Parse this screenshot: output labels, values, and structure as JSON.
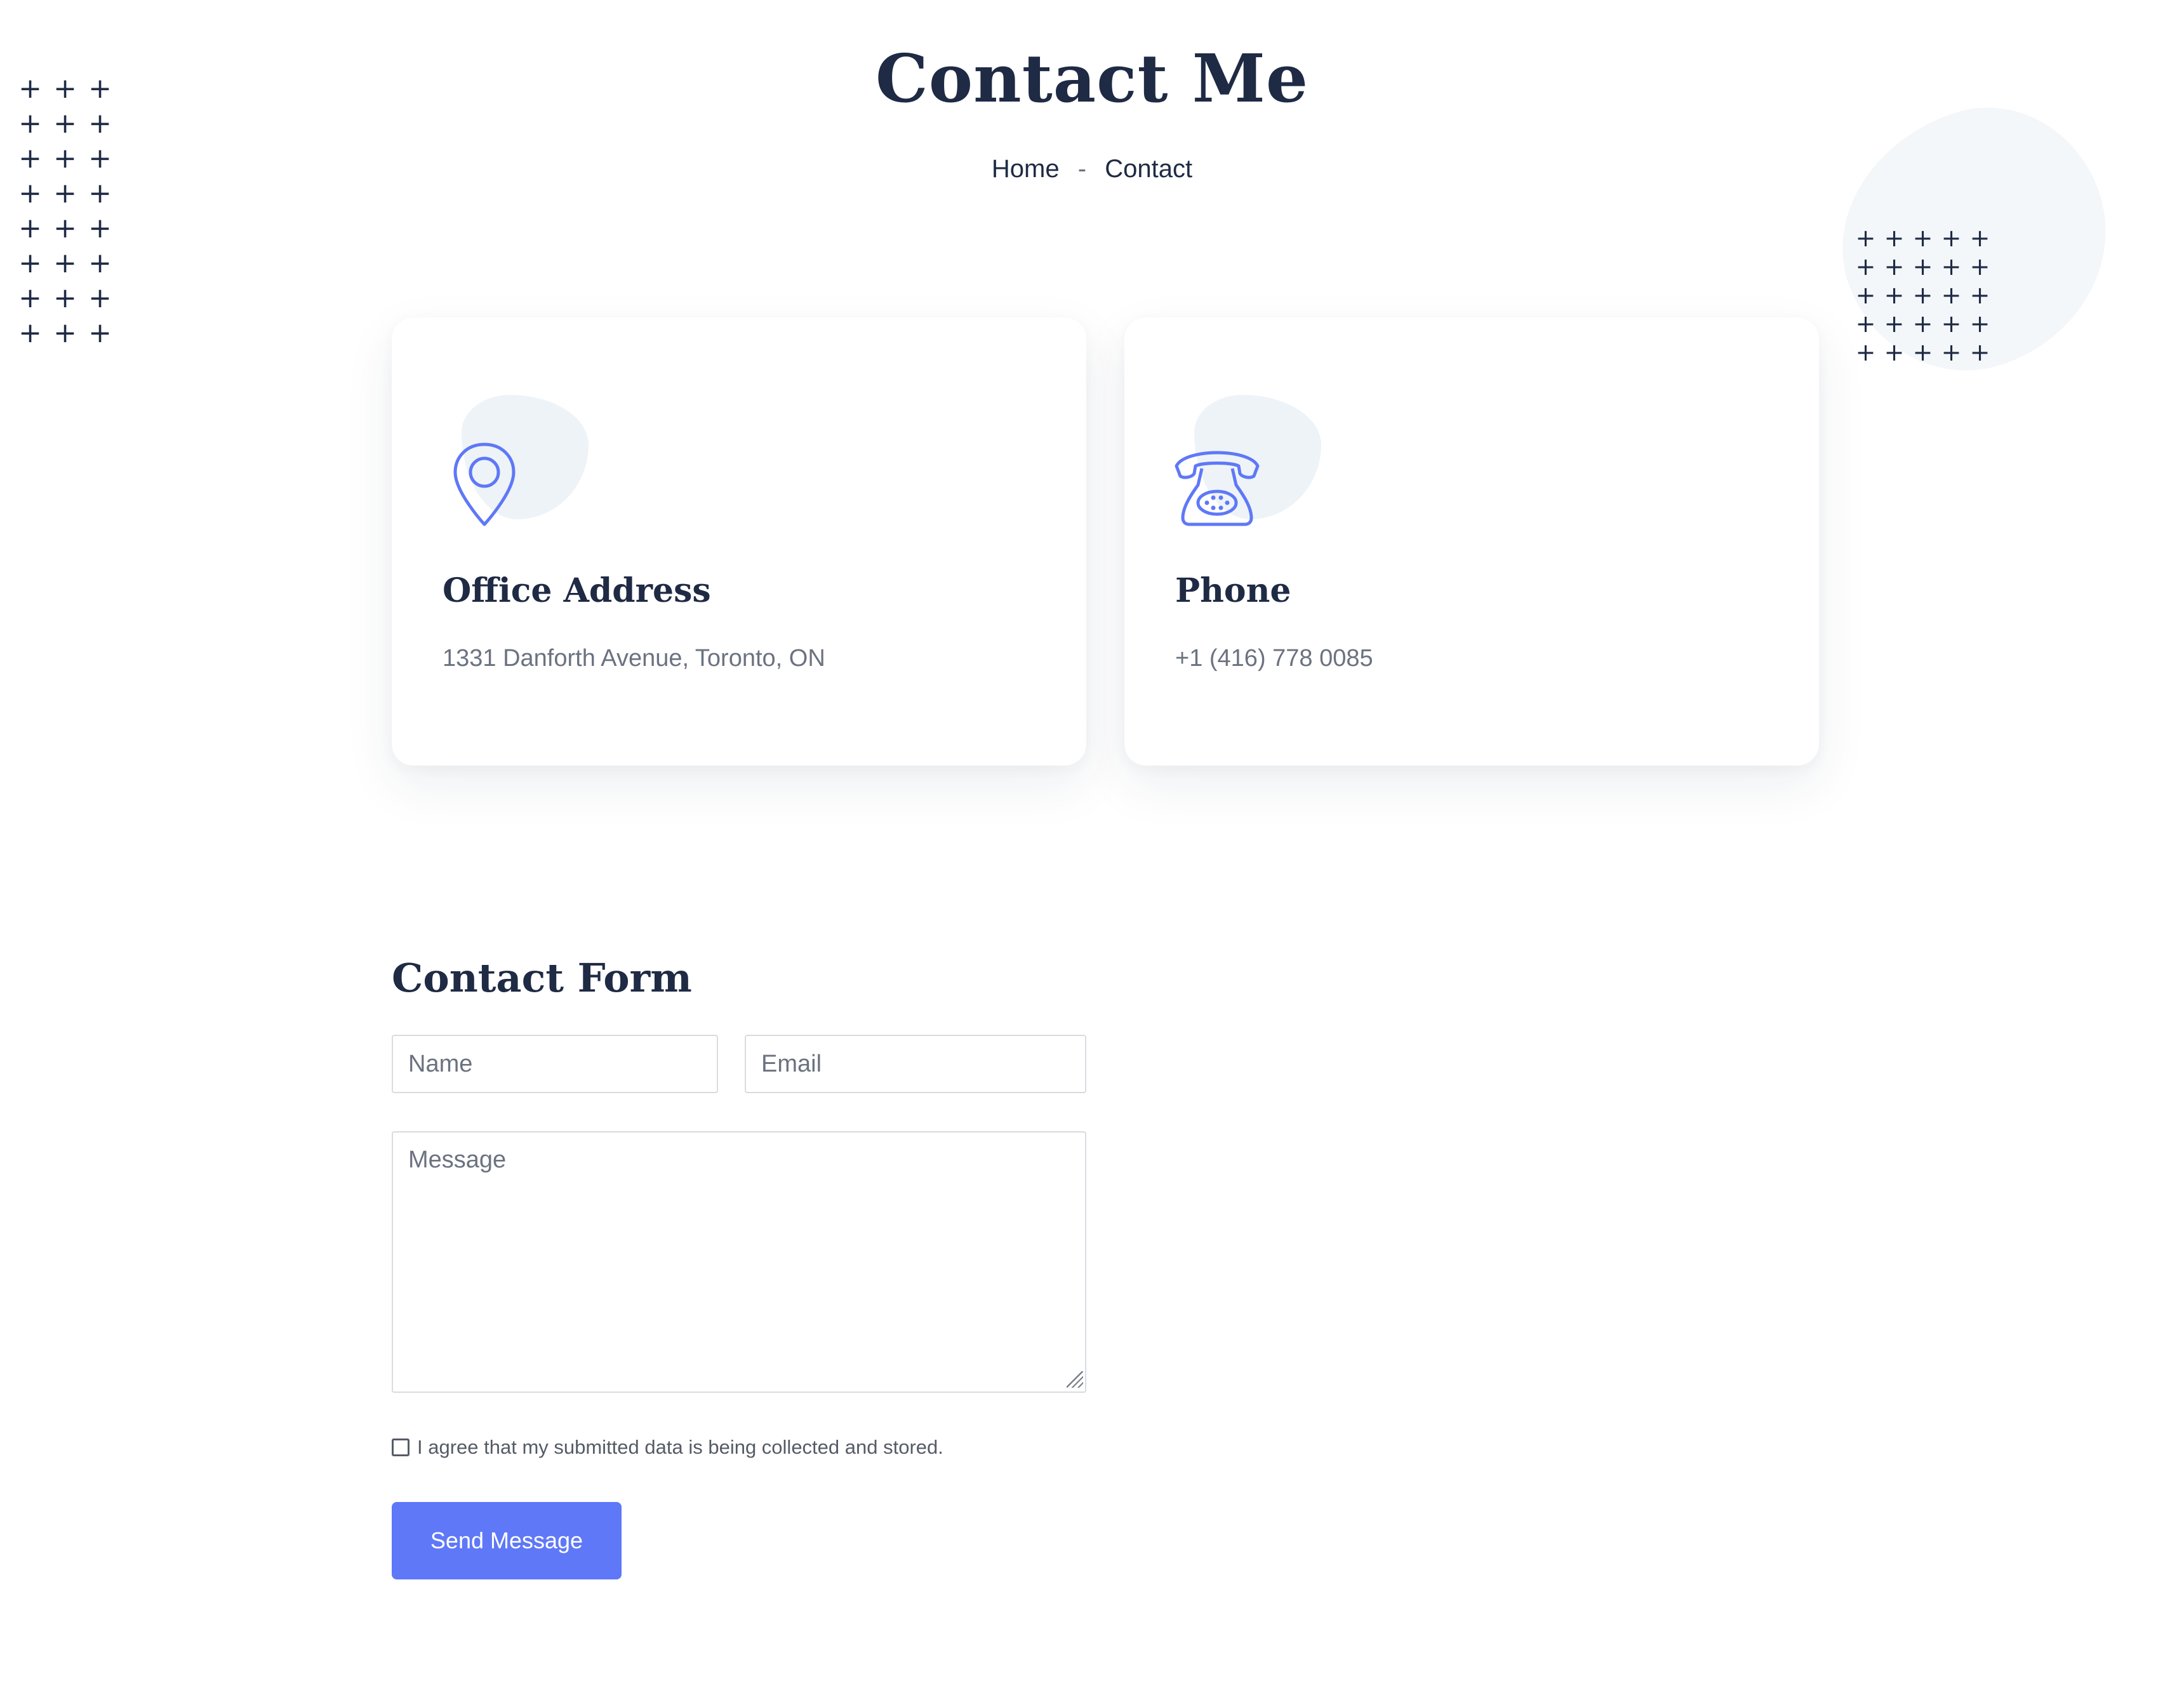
{
  "header": {
    "title": "Contact Me",
    "breadcrumb": {
      "home": "Home",
      "separator": "-",
      "current": "Contact"
    }
  },
  "cards": {
    "address": {
      "icon": "map-pin-icon",
      "title": "Office Address",
      "text": "1331 Danforth Avenue, Toronto, ON"
    },
    "phone": {
      "icon": "telephone-icon",
      "title": "Phone",
      "text": "+1 (416) 778 0085"
    }
  },
  "form": {
    "title": "Contact Form",
    "name_placeholder": "Name",
    "email_placeholder": "Email",
    "message_placeholder": "Message",
    "consent_label": "I agree that my submitted data is being collected and stored.",
    "consent_checked": false,
    "submit_label": "Send Message"
  },
  "colors": {
    "heading": "#1f2a44",
    "body_text": "#6b7280",
    "accent": "#5f78f7",
    "icon_blob": "#eef3f7"
  }
}
